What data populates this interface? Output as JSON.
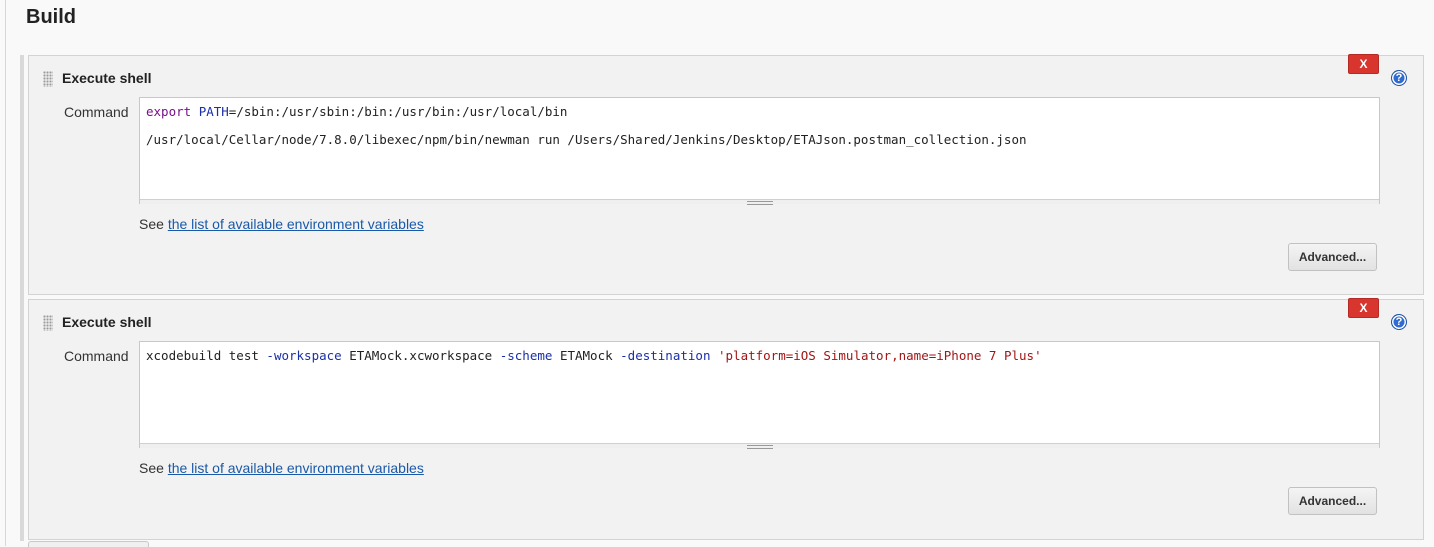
{
  "section": {
    "title": "Build"
  },
  "steps": [
    {
      "title": "Execute shell",
      "delete_label": "X",
      "help_label": "?",
      "command_label": "Command",
      "command_lines": [
        [
          {
            "t": "export",
            "c": "kw"
          },
          {
            "t": " ",
            "c": ""
          },
          {
            "t": "PATH",
            "c": "var"
          },
          {
            "t": "=/sbin:/usr/sbin:/bin:/usr/bin:/usr/local/bin",
            "c": ""
          }
        ],
        [
          {
            "t": "/usr/local/Cellar/node/7.8.0/libexec/npm/bin/newman run /Users/Shared/Jenkins/Desktop/ETAJson.postman_collection.json",
            "c": ""
          }
        ]
      ],
      "see_text": "See ",
      "env_link": "the list of available environment variables",
      "advanced_label": "Advanced..."
    },
    {
      "title": "Execute shell",
      "delete_label": "X",
      "help_label": "?",
      "command_label": "Command",
      "command_lines": [
        [
          {
            "t": "xcodebuild test ",
            "c": ""
          },
          {
            "t": "-workspace",
            "c": "flag"
          },
          {
            "t": " ETAMock.xcworkspace ",
            "c": ""
          },
          {
            "t": "-scheme",
            "c": "flag"
          },
          {
            "t": " ETAMock ",
            "c": ""
          },
          {
            "t": "-destination",
            "c": "flag"
          },
          {
            "t": " ",
            "c": ""
          },
          {
            "t": "'platform=iOS Simulator,name=iPhone 7 Plus'",
            "c": "str"
          }
        ]
      ],
      "see_text": "See ",
      "env_link": "the list of available environment variables",
      "advanced_label": "Advanced..."
    }
  ],
  "colors": {
    "delete_button": "#d9352f",
    "help_icon": "#2f6bd0",
    "link": "#1a59a8"
  }
}
